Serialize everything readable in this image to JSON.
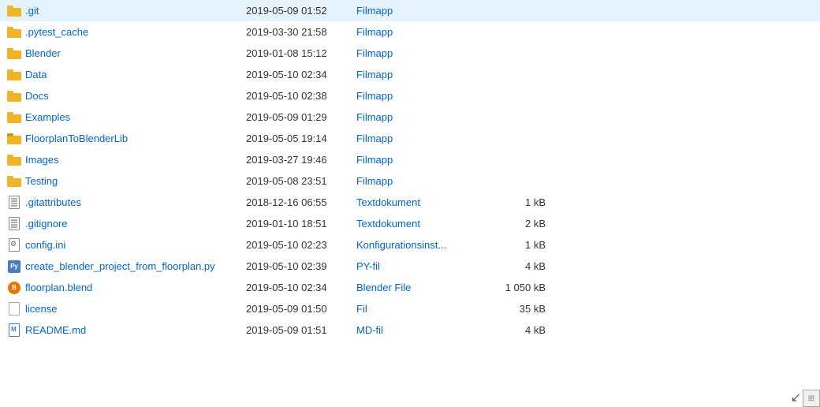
{
  "files": [
    {
      "name": ".git",
      "date": "2019-05-09 01:52",
      "type": "Filmapp",
      "size": "",
      "icon": "folder"
    },
    {
      "name": ".pytest_cache",
      "date": "2019-03-30 21:58",
      "type": "Filmapp",
      "size": "",
      "icon": "folder"
    },
    {
      "name": "Blender",
      "date": "2019-01-08 15:12",
      "type": "Filmapp",
      "size": "",
      "icon": "folder"
    },
    {
      "name": "Data",
      "date": "2019-05-10 02:34",
      "type": "Filmapp",
      "size": "",
      "icon": "folder"
    },
    {
      "name": "Docs",
      "date": "2019-05-10 02:38",
      "type": "Filmapp",
      "size": "",
      "icon": "folder"
    },
    {
      "name": "Examples",
      "date": "2019-05-09 01:29",
      "type": "Filmapp",
      "size": "",
      "icon": "folder"
    },
    {
      "name": "FloorplanToBlenderLib",
      "date": "2019-05-05 19:14",
      "type": "Filmapp",
      "size": "",
      "icon": "folder-stripe"
    },
    {
      "name": "Images",
      "date": "2019-03-27 19:46",
      "type": "Filmapp",
      "size": "",
      "icon": "folder"
    },
    {
      "name": "Testing",
      "date": "2019-05-08 23:51",
      "type": "Filmapp",
      "size": "",
      "icon": "folder"
    },
    {
      "name": ".gitattributes",
      "date": "2018-12-16 06:55",
      "type": "Textdokument",
      "size": "1 kB",
      "icon": "text"
    },
    {
      "name": ".gitignore",
      "date": "2019-01-10 18:51",
      "type": "Textdokument",
      "size": "2 kB",
      "icon": "text"
    },
    {
      "name": "config.ini",
      "date": "2019-05-10 02:23",
      "type": "Konfigurationsinst...",
      "size": "1 kB",
      "icon": "config"
    },
    {
      "name": "create_blender_project_from_floorplan.py",
      "date": "2019-05-10 02:39",
      "type": "PY-fil",
      "size": "4 kB",
      "icon": "py"
    },
    {
      "name": "floorplan.blend",
      "date": "2019-05-10 02:34",
      "type": "Blender File",
      "size": "1 050 kB",
      "icon": "blend"
    },
    {
      "name": "license",
      "date": "2019-05-09 01:50",
      "type": "Fil",
      "size": "35 kB",
      "icon": "generic"
    },
    {
      "name": "README.md",
      "date": "2019-05-09 01:51",
      "type": "MD-fil",
      "size": "4 kB",
      "icon": "md"
    }
  ],
  "resize_button_label": "⊞",
  "arrow_label": "↙"
}
